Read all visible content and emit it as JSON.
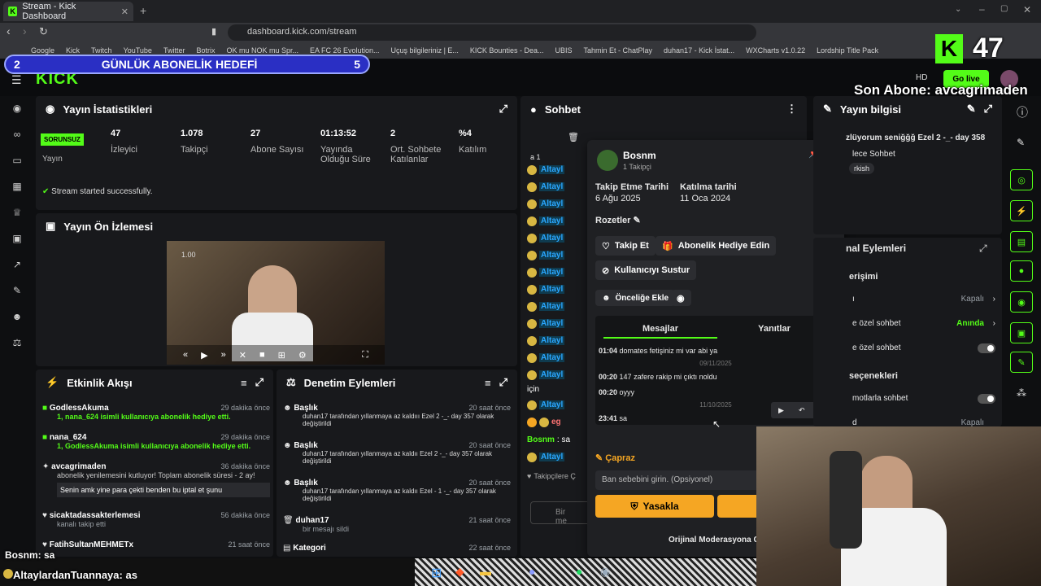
{
  "browser": {
    "tab_title": "Stream - Kick Dashboard",
    "url": "dashboard.kick.com/stream",
    "bookmarks": [
      "Google",
      "Kick",
      "Twitch",
      "YouTube",
      "Twitter",
      "Botrix",
      "OK mu NOK mu Spr...",
      "EA FC 26 Evolution...",
      "Uçuş bilgileriniz | E...",
      "KICK Bounties - Dea...",
      "UBIS",
      "Tahmin Et - ChatPlay",
      "duhan17 - Kick İstat...",
      "WXCharts v1.0.22",
      "Lordship Title Pack"
    ]
  },
  "overlay": {
    "goal_count_left": "2",
    "goal_title": "GÜNLÜK ABONELİK HEDEFİ",
    "goal_count_right": "5",
    "sub_count": "47",
    "last_sub": "Son Abone: avcagrimaden",
    "chat1_user": "Bosnm",
    "chat1_msg": ": sa",
    "chat2_user": "AltaylardanTuannaya",
    "chat2_msg": ": as"
  },
  "header": {
    "go_live": "Go live"
  },
  "stats": {
    "title": "Yayın İstatistikleri",
    "status_badge": "SORUNSUZ",
    "status_label": "Yayın",
    "items": [
      {
        "value": "47",
        "label": "İzleyici"
      },
      {
        "value": "1.078",
        "label": "Takipçi"
      },
      {
        "value": "27",
        "label": "Abone Sayısı"
      },
      {
        "value": "01:13:52",
        "label": "Yayında Olduğu Süre"
      },
      {
        "value": "2",
        "label": "Ort. Sohbete Katılanlar"
      },
      {
        "value": "%4",
        "label": "Katılım"
      }
    ],
    "success_msg": "Stream started successfully."
  },
  "preview": {
    "title": "Yayın Ön İzlemesi",
    "mini_zoom": "1.00"
  },
  "activity": {
    "title": "Etkinlik Akışı",
    "items": [
      {
        "name": "GodlessAkuma",
        "time": "29 dakika önce",
        "desc": "1, nana_624 isimli kullanıcıya abonelik hediye etti."
      },
      {
        "name": "nana_624",
        "time": "29 dakika önce",
        "desc": "1, GodlessAkuma isimli kullanıcıya abonelik hediye etti."
      },
      {
        "name": "avcagrimaden",
        "time": "36 dakika önce",
        "desc": "abonelik yenilemesini kutluyor! Toplam abonelik süresi - 2 ay!",
        "quote": "Senin amk yine para çekti benden bu iptal et şunu"
      },
      {
        "name": "sicaktadassakterlemesi",
        "time": "56 dakika önce",
        "desc": "kanalı takip etti"
      },
      {
        "name": "FatihSultanMEHMETx",
        "time": "21 saat önce",
        "desc": ""
      }
    ]
  },
  "moderation": {
    "title": "Denetim Eylemleri",
    "items": [
      {
        "name": "Başlık",
        "time": "20 saat önce",
        "desc": "duhan17 tarafından yıllanmaya az kaldııı Ezel 2 -_- day 357 olarak değiştirildi"
      },
      {
        "name": "Başlık",
        "time": "20 saat önce",
        "desc": "duhan17 tarafından yıllanmaya az kaldıı Ezel 2 -_- day 357 olarak değiştirildi"
      },
      {
        "name": "Başlık",
        "time": "20 saat önce",
        "desc": "duhan17 tarafından yıllanmaya az kaldıı Ezel - 1 -_- day 357 olarak değiştirildi"
      },
      {
        "name": "duhan17",
        "time": "21 saat önce",
        "desc": "bir mesajı sildi"
      },
      {
        "name": "Kategori",
        "time": "22 saat önce",
        "desc": ""
      }
    ]
  },
  "chat": {
    "title": "Sohbet",
    "row_label": "Altayl",
    "line_b1": "a 1",
    "line_icin": "için",
    "line_eg": "eg",
    "bosnm_user": "Bosnm",
    "bosnm_msg": ": sa",
    "followers_label": "Takipçilere Ç",
    "send_placeholder": "Bir me"
  },
  "user_card": {
    "username": "Bosnm",
    "followers": "1 Takipçi",
    "follow_date_label": "Takip Etme Tarihi",
    "follow_date": "6 Ağu 2025",
    "join_date_label": "Katılma tarihi",
    "join_date": "11 Oca 2024",
    "badges_label": "Rozetler",
    "follow_btn": "Takip Et",
    "gift_btn": "Abonelik Hediye Edin",
    "mute_btn": "Kullanıcıyı Sustur",
    "priority_btn": "Önceliğe Ekle",
    "tabs": [
      "Mesajlar",
      "Yanıtlar"
    ],
    "messages": [
      {
        "time": "01:04",
        "text": "domates fetişiniz mi var abi ya"
      },
      {
        "date": "09/11/2025"
      },
      {
        "time": "00:20",
        "text": "147 zafere rakip mi çıktı noldu"
      },
      {
        "time": "00:20",
        "text": "oyyy"
      },
      {
        "date": "11/10/2025"
      },
      {
        "time": "23:41",
        "text": "sa"
      }
    ],
    "cross_label": "Çapraz",
    "ban_placeholder": "Ban sebebini girin. (Opsiyonel)",
    "ban_btn": "Yasakla",
    "original_mod": "Orijinal Moderasyona Ge"
  },
  "stream_info": {
    "title": "Yayın bilgisi",
    "stream_title": "zlüyorum seniğğğ Ezel 2 -_- day 358",
    "category": "lece Sohbet",
    "tag": "rkish"
  },
  "channel_actions": {
    "title": "nal Eylemleri",
    "access": "erişimi",
    "rows": [
      {
        "label": "ı",
        "value": "Kapalı"
      },
      {
        "label": "e özel sohbet",
        "value": "Anında"
      },
      {
        "label": "e özel sohbet",
        "value": ""
      }
    ],
    "options_title": "seçenekleri",
    "options_rows": [
      {
        "label": "motlarla sohbet",
        "value": ""
      },
      {
        "label": "d",
        "value": "Kapalı"
      }
    ]
  }
}
